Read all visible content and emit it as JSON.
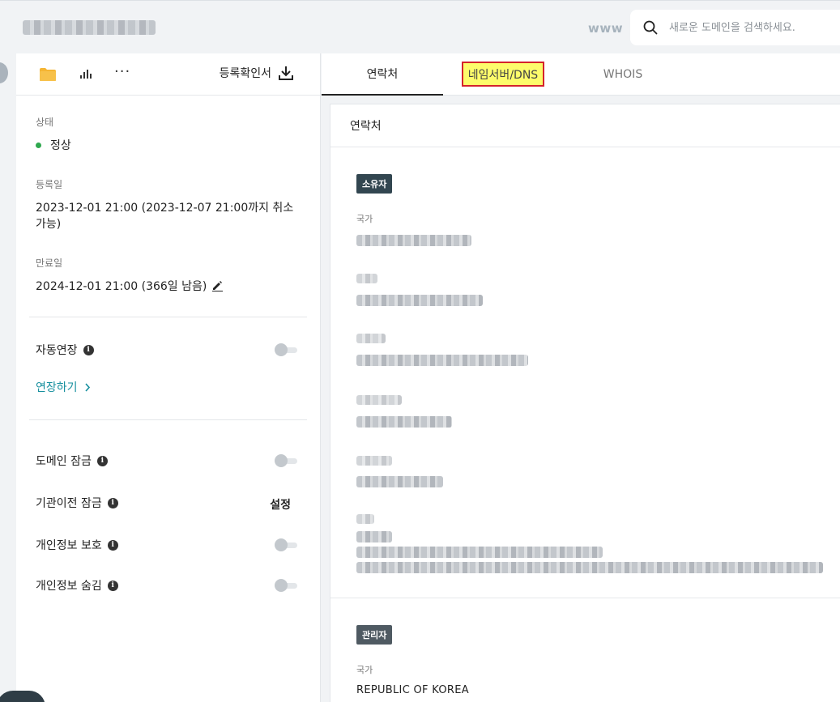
{
  "search": {
    "www_label": "www",
    "placeholder": "새로운 도메인을 검색하세요."
  },
  "toolbar": {
    "certificate_label": "등록확인서"
  },
  "status": {
    "label": "상태",
    "value": "정상",
    "status_color": "#2fa84f"
  },
  "registered": {
    "label": "등록일",
    "value": "2023-12-01 21:00 (2023-12-07 21:00까지 취소 가능)"
  },
  "expires": {
    "label": "만료일",
    "value": "2024-12-01 21:00 (366일 남음)"
  },
  "auto_renew": {
    "label": "자동연장",
    "enabled": false,
    "extend_link": "연장하기"
  },
  "settings": [
    {
      "label": "도메인 잠금",
      "control": "toggle",
      "enabled": false
    },
    {
      "label": "기관이전 잠금",
      "control": "button",
      "button_label": "설정"
    },
    {
      "label": "개인정보 보호",
      "control": "toggle",
      "enabled": false
    },
    {
      "label": "개인정보 숨김",
      "control": "toggle",
      "enabled": false
    }
  ],
  "tabs": [
    {
      "label": "연락처",
      "active": true
    },
    {
      "label": "네임서버/DNS",
      "active": false,
      "highlighted": true
    },
    {
      "label": "WHOIS",
      "active": false
    }
  ],
  "contacts": {
    "title": "연락처",
    "owner": {
      "badge": "소유자",
      "country_label": "국가"
    },
    "admin": {
      "badge": "관리자",
      "country_label": "국가",
      "country_value": "REPUBLIC OF KOREA"
    }
  }
}
